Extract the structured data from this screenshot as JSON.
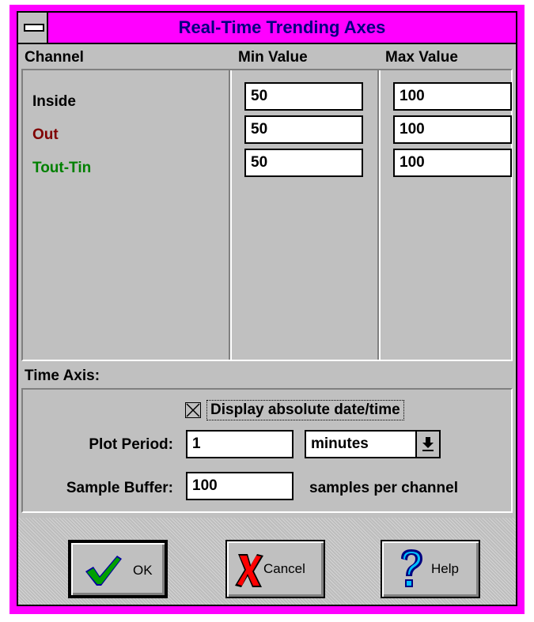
{
  "window": {
    "title": "Real-Time Trending Axes",
    "frame_color": "#ff00ff",
    "title_color": "#000080"
  },
  "columns": {
    "channel": "Channel",
    "min": "Min Value",
    "max": "Max Value"
  },
  "channels": [
    {
      "name": "Inside",
      "color": "#000000",
      "min": "50",
      "max": "100"
    },
    {
      "name": "Out",
      "color": "#800000",
      "min": "50",
      "max": "100"
    },
    {
      "name": "Tout-Tin",
      "color": "#008000",
      "min": "50",
      "max": "100"
    }
  ],
  "time_axis": {
    "label": "Time Axis:",
    "display_absolute_label": "Display absolute date/time",
    "display_absolute_checked": true,
    "plot_period_label": "Plot Period:",
    "plot_period_value": "1",
    "units_selected": "minutes",
    "sample_buffer_label": "Sample Buffer:",
    "sample_buffer_value": "100",
    "samples_suffix": "samples per channel"
  },
  "buttons": {
    "ok": "OK",
    "cancel": "Cancel",
    "help": "Help"
  },
  "icons": {
    "system_menu": "system-menu-icon",
    "ok": "checkmark-icon",
    "cancel": "red-x-icon",
    "help": "question-mark-icon",
    "dropdown": "dropdown-arrow-icon"
  }
}
